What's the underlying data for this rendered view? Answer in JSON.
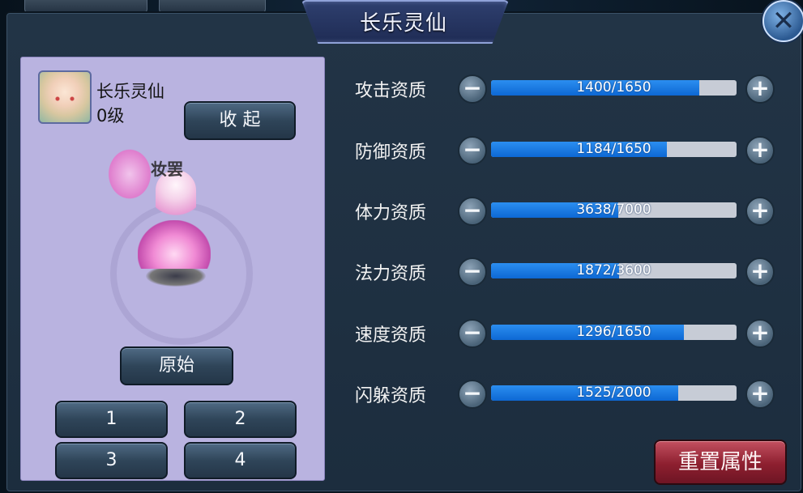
{
  "window": {
    "title": "长乐灵仙",
    "close_icon": "close-icon"
  },
  "pet": {
    "name": "长乐灵仙",
    "level": "0级",
    "collapse_label": "收 起",
    "original_label": "原始",
    "status_label": "妆罢",
    "slots": [
      "1",
      "2",
      "3",
      "4"
    ]
  },
  "stats": [
    {
      "label": "攻击资质",
      "value": 1400,
      "max": 1650,
      "text": "1400/1650"
    },
    {
      "label": "防御资质",
      "value": 1184,
      "max": 1650,
      "text": "1184/1650"
    },
    {
      "label": "体力资质",
      "value": 3638,
      "max": 7000,
      "text": "3638/7000"
    },
    {
      "label": "法力资质",
      "value": 1872,
      "max": 3600,
      "text": "1872/3600"
    },
    {
      "label": "速度资质",
      "value": 1296,
      "max": 1650,
      "text": "1296/1650"
    },
    {
      "label": "闪躲资质",
      "value": 1525,
      "max": 2000,
      "text": "1525/2000"
    }
  ],
  "controls": {
    "minus_icon": "minus-icon",
    "plus_icon": "plus-icon"
  },
  "reset_label": "重置属性",
  "colors": {
    "bar_fill": "#1a7ae6",
    "bar_track": "#c7ccd6",
    "reset": "#a3303f",
    "card": "#b9b3e0"
  }
}
